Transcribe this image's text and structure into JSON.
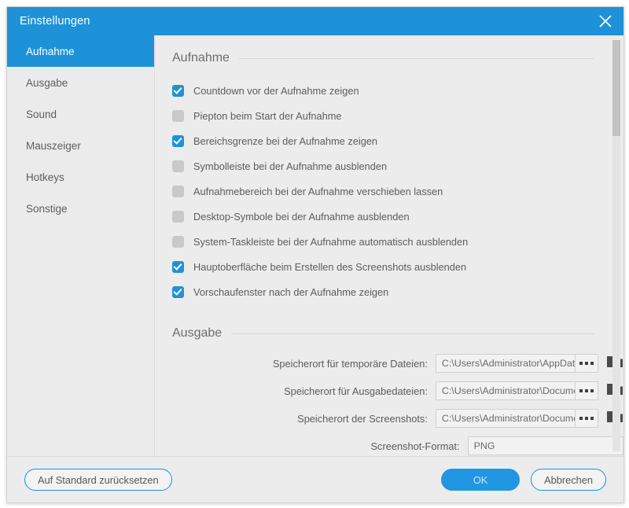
{
  "window": {
    "title": "Einstellungen",
    "close_icon": "close-icon",
    "accent_color": "#1e92d8",
    "background_color": "#ececec"
  },
  "sidebar": {
    "items": [
      {
        "label": "Aufnahme",
        "active": true
      },
      {
        "label": "Ausgabe",
        "active": false
      },
      {
        "label": "Sound",
        "active": false
      },
      {
        "label": "Mauszeiger",
        "active": false
      },
      {
        "label": "Hotkeys",
        "active": false
      },
      {
        "label": "Sonstige",
        "active": false
      }
    ]
  },
  "recording_section": {
    "title": "Aufnahme",
    "options": [
      {
        "label": "Countdown vor der Aufnahme zeigen",
        "checked": true
      },
      {
        "label": "Piepton beim Start der Aufnahme",
        "checked": false
      },
      {
        "label": "Bereichsgrenze bei der Aufnahme zeigen",
        "checked": true
      },
      {
        "label": "Symbolleiste bei der Aufnahme ausblenden",
        "checked": false
      },
      {
        "label": "Aufnahmebereich bei der Aufnahme verschieben lassen",
        "checked": false
      },
      {
        "label": "Desktop-Symbole bei der Aufnahme ausblenden",
        "checked": false
      },
      {
        "label": "System-Taskleiste bei der Aufnahme automatisch ausblenden",
        "checked": false
      },
      {
        "label": "Hauptoberfläche beim Erstellen des Screenshots ausblenden",
        "checked": true
      },
      {
        "label": "Vorschaufenster nach der Aufnahme zeigen",
        "checked": true
      }
    ]
  },
  "output_section": {
    "title": "Ausgabe",
    "fields": [
      {
        "label": "Speicherort für temporäre Dateien:",
        "value": "C:\\Users\\Administrator\\AppData\\Lo",
        "browse_label": "browse-dots",
        "folder_icon": "folder-icon"
      },
      {
        "label": "Speicherort für Ausgabedateien:",
        "value": "C:\\Users\\Administrator\\Documents",
        "browse_label": "browse-dots",
        "folder_icon": "folder-icon"
      },
      {
        "label": "Speicherort der Screenshots:",
        "value": "C:\\Users\\Administrator\\Documents",
        "browse_label": "browse-dots",
        "folder_icon": "folder-icon"
      }
    ],
    "cut_off_field": {
      "label": "Screenshot-Format:",
      "value": "PNG"
    }
  },
  "footer": {
    "reset_label": "Auf Standard zurücksetzen",
    "ok_label": "OK",
    "cancel_label": "Abbrechen"
  }
}
